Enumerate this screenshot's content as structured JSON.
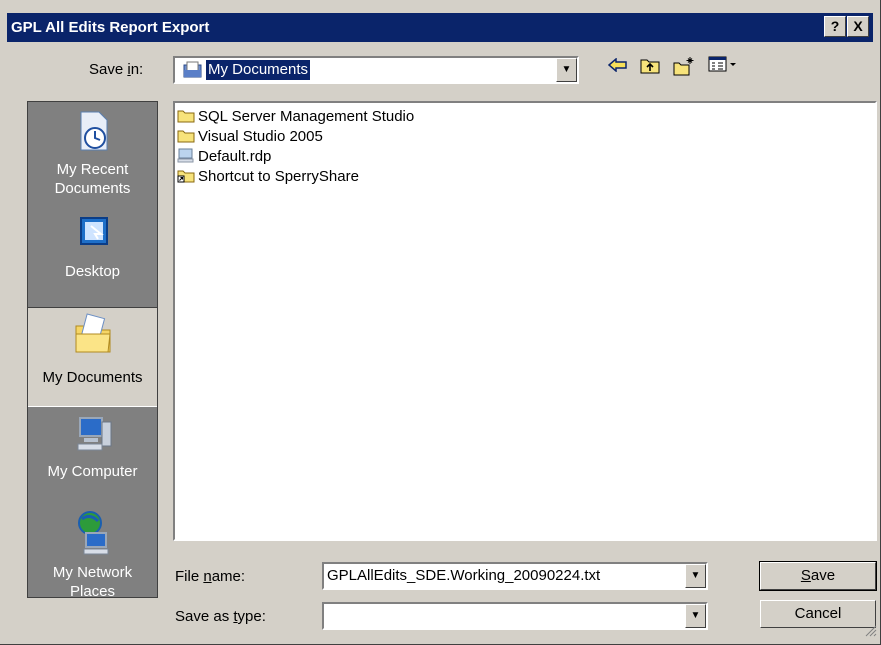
{
  "window": {
    "title": "GPL All Edits Report Export",
    "help_label": "?",
    "close_label": "X"
  },
  "save_in": {
    "label_pre": "Save ",
    "label_u": "i",
    "label_post": "n:",
    "value": "My Documents"
  },
  "places": [
    {
      "line1": "My Recent",
      "line2": "Documents",
      "icon": "recent-documents-icon"
    },
    {
      "line1": "Desktop",
      "line2": "",
      "icon": "desktop-icon"
    },
    {
      "line1": "My Documents",
      "line2": "",
      "icon": "my-documents-icon"
    },
    {
      "line1": "My Computer",
      "line2": "",
      "icon": "my-computer-icon"
    },
    {
      "line1": "My Network",
      "line2": "Places",
      "icon": "network-places-icon"
    }
  ],
  "files": [
    {
      "name": "SQL Server Management Studio",
      "icon": "folder-icon"
    },
    {
      "name": "Visual Studio 2005",
      "icon": "folder-icon"
    },
    {
      "name": "Default.rdp",
      "icon": "rdp-file-icon"
    },
    {
      "name": "Shortcut to SperryShare",
      "icon": "folder-shortcut-icon"
    }
  ],
  "file_name": {
    "label_pre": "File ",
    "label_u": "n",
    "label_post": "ame:",
    "value": "GPLAllEdits_SDE.Working_20090224.txt"
  },
  "save_type": {
    "label_pre": "Save as ",
    "label_u": "t",
    "label_post": "ype:",
    "value": ""
  },
  "buttons": {
    "save_u": "S",
    "save_rest": "ave",
    "cancel": "Cancel"
  }
}
